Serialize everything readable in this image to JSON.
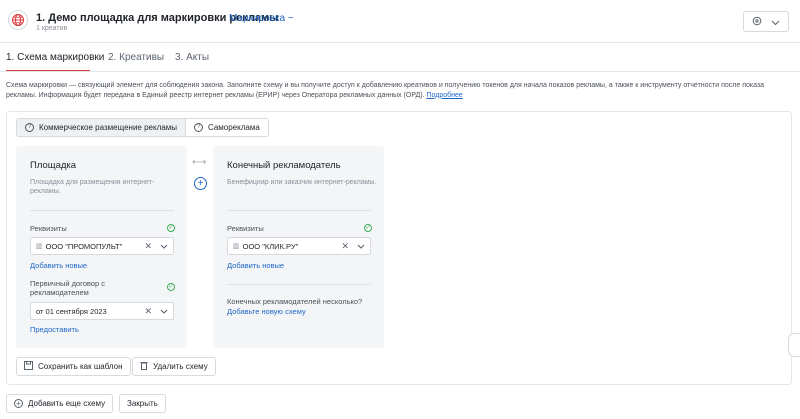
{
  "header": {
    "title": "1. Демо площадка для маркировки рекламы",
    "tag": "Маркировка ~",
    "subtitle": "1 креатив",
    "globe_icon": "globe-icon"
  },
  "tabs": [
    {
      "label": "1. Схема маркировки",
      "active": true
    },
    {
      "label": "2. Креативы",
      "active": false
    },
    {
      "label": "3. Акты",
      "active": false
    }
  ],
  "description": {
    "text": "Схема маркировки — связующий элемент для соблюдения закона. Заполните схему и вы получите доступ к добавлению креативов и получению токенов для начала показов рекламы, а также к инструменту отчетности после показа рекламы. Информация будет передана в Единый реестр интернет рекламы (ЕРИР) через Оператора рекламных данных (ОРД).",
    "link": "Подробнее"
  },
  "segment": {
    "options": [
      "Коммерческое размещение рекламы",
      "Самореклама"
    ],
    "selected": "Коммерческое размещение рекламы"
  },
  "platform_panel": {
    "title": "Площадка",
    "description": "Площадка для размещения интернет-рекламы.",
    "requisites_label": "Реквизиты",
    "requisites_value": "ООО \"ПРОМОПУЛЬТ\"",
    "add_new_link": "Добавить новые",
    "contract_label": "Первичный договор с рекламодателем",
    "contract_value": "от 01 сентября 2023",
    "provide_link": "Предоставить"
  },
  "advertiser_panel": {
    "title": "Конечный рекламодатель",
    "description": "Бенефициар или заказчик интернет-рекламы.",
    "requisites_label": "Реквизиты",
    "requisites_value": "ООО \"КЛИК.РУ\"",
    "add_new_link": "Добавить новые",
    "several_question": "Конечных рекламодателей несколько?",
    "add_scheme_link": "Добавьте новую схему"
  },
  "buttons": {
    "save_template": "Сохранить как шаблон",
    "delete_scheme": "Удалить схему",
    "add_scheme": "Добавить еще схему",
    "close": "Закрыть"
  },
  "colors": {
    "accent_link": "#1f66c7",
    "active_tab": "#d93b3b",
    "success": "#3fae5a",
    "panel_bg": "#f3f5f7"
  }
}
